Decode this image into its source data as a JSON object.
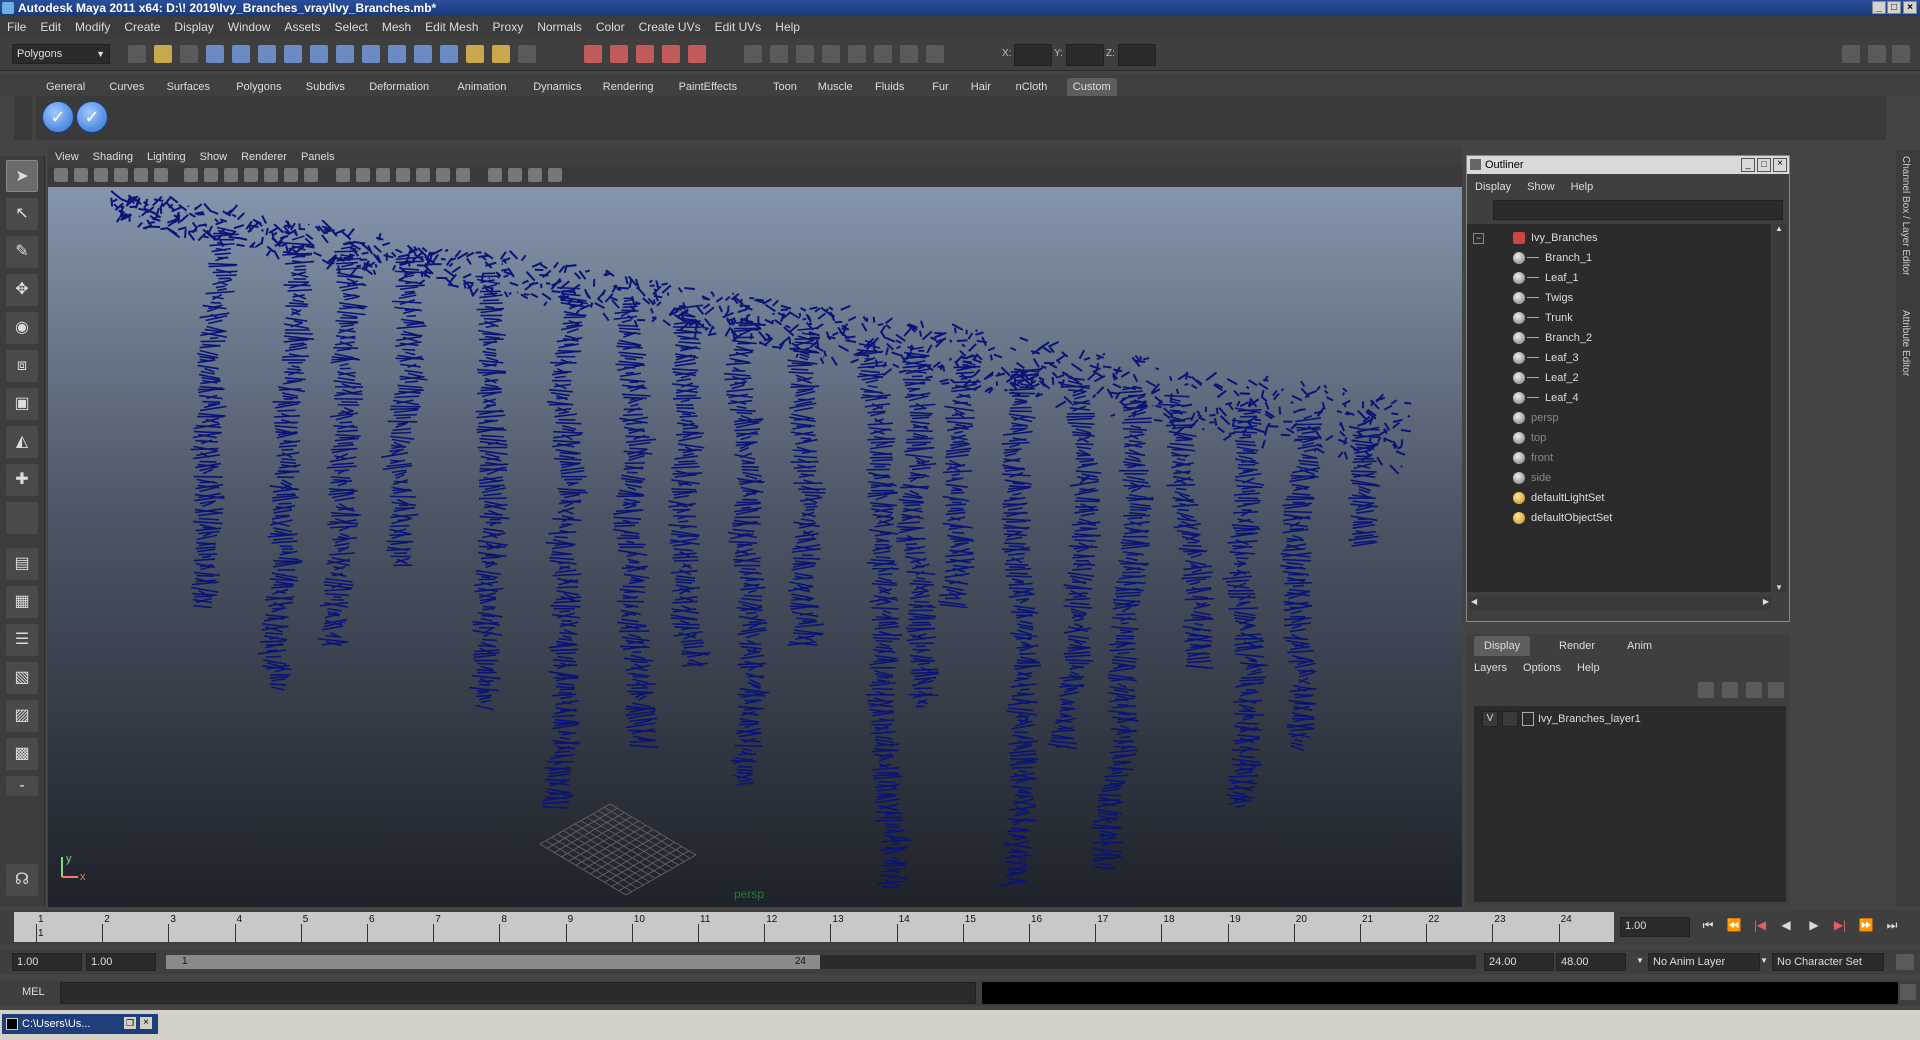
{
  "window": {
    "title": "Autodesk Maya 2011 x64: D:\\! 2019\\Ivy_Branches_vray\\Ivy_Branches.mb*"
  },
  "menubar": [
    "File",
    "Edit",
    "Modify",
    "Create",
    "Display",
    "Window",
    "Assets",
    "Select",
    "Mesh",
    "Edit Mesh",
    "Proxy",
    "Normals",
    "Color",
    "Create UVs",
    "Edit UVs",
    "Help"
  ],
  "statusline": {
    "mode": "Polygons",
    "x_label": "X:",
    "y_label": "Y:",
    "z_label": "Z:"
  },
  "shelf_tabs": [
    "General",
    "Curves",
    "Surfaces",
    "Polygons",
    "Subdivs",
    "Deformation",
    "Animation",
    "Dynamics",
    "Rendering",
    "PaintEffects",
    "Toon",
    "Muscle",
    "Fluids",
    "Fur",
    "Hair",
    "nCloth",
    "Custom"
  ],
  "shelf_active": "Custom",
  "panel_menu": [
    "View",
    "Shading",
    "Lighting",
    "Show",
    "Renderer",
    "Panels"
  ],
  "viewport": {
    "camera_label": "persp",
    "axis_x": "x",
    "axis_y": "y"
  },
  "outliner": {
    "title": "Outliner",
    "menu": [
      "Display",
      "Show",
      "Help"
    ],
    "items": [
      {
        "label": "Ivy_Branches",
        "indent": 0,
        "kind": "group"
      },
      {
        "label": "Branch_1",
        "indent": 1,
        "kind": "mesh"
      },
      {
        "label": "Leaf_1",
        "indent": 1,
        "kind": "mesh"
      },
      {
        "label": "Twigs",
        "indent": 1,
        "kind": "mesh"
      },
      {
        "label": "Trunk",
        "indent": 1,
        "kind": "mesh"
      },
      {
        "label": "Branch_2",
        "indent": 1,
        "kind": "mesh"
      },
      {
        "label": "Leaf_3",
        "indent": 1,
        "kind": "mesh"
      },
      {
        "label": "Leaf_2",
        "indent": 1,
        "kind": "mesh"
      },
      {
        "label": "Leaf_4",
        "indent": 1,
        "kind": "mesh"
      },
      {
        "label": "persp",
        "indent": 0,
        "kind": "camera"
      },
      {
        "label": "top",
        "indent": 0,
        "kind": "camera"
      },
      {
        "label": "front",
        "indent": 0,
        "kind": "camera"
      },
      {
        "label": "side",
        "indent": 0,
        "kind": "camera"
      },
      {
        "label": "defaultLightSet",
        "indent": 0,
        "kind": "set"
      },
      {
        "label": "defaultObjectSet",
        "indent": 0,
        "kind": "set"
      }
    ]
  },
  "layer_editor": {
    "tabs": [
      "Display",
      "Render",
      "Anim"
    ],
    "menu": [
      "Layers",
      "Options",
      "Help"
    ],
    "layer_visible": "V",
    "layer_name": "Ivy_Branches_layer1"
  },
  "side_tabs": [
    "Channel Box / Layer Editor",
    "Attribute Editor"
  ],
  "timeline": {
    "ticks": [
      "1",
      "2",
      "3",
      "4",
      "5",
      "6",
      "7",
      "8",
      "9",
      "10",
      "11",
      "12",
      "13",
      "14",
      "15",
      "16",
      "17",
      "18",
      "19",
      "20",
      "21",
      "22",
      "23",
      "24"
    ],
    "current_frame": "1.00",
    "current_marker": "1"
  },
  "range": {
    "start": "1.00",
    "inner_start": "1.00",
    "slider_start": "1",
    "slider_end": "24",
    "end": "24.00",
    "outer_end": "48.00",
    "anim_layer": "No Anim Layer",
    "character_set": "No Character Set"
  },
  "command": {
    "label": "MEL"
  },
  "taskbar": {
    "item": "C:\\Users\\Us..."
  },
  "colors": {
    "wire": "#0a1478",
    "viewport_top": "#8595ac",
    "viewport_bottom": "#1e2229"
  }
}
